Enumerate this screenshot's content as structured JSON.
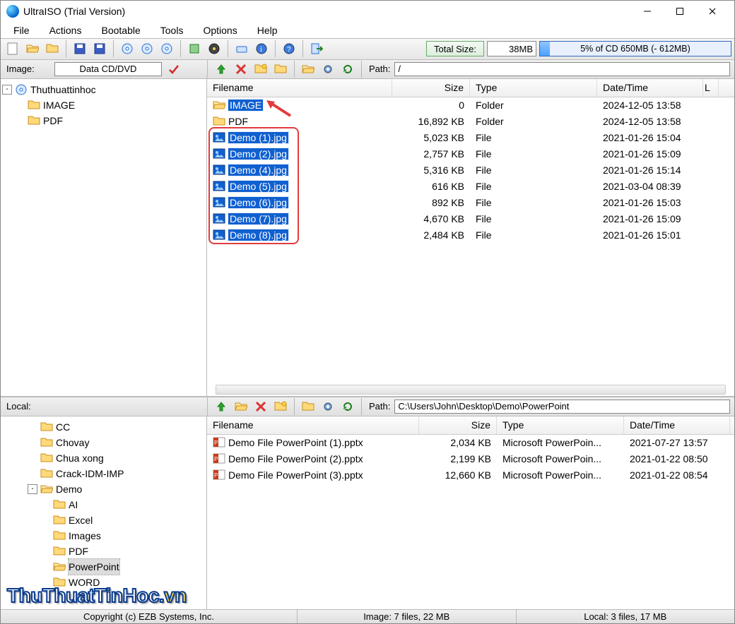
{
  "window": {
    "title": "UltraISO (Trial Version)"
  },
  "menu": [
    "File",
    "Actions",
    "Bootable",
    "Tools",
    "Options",
    "Help"
  ],
  "sizebar": {
    "label": "Total Size:",
    "value": "38MB",
    "progress_text": "5% of CD 650MB (- 612MB)",
    "progress_pct": 5
  },
  "image_toolbar": {
    "label": "Image:",
    "type_box": "Data CD/DVD",
    "path_label": "Path:",
    "path_value": "/"
  },
  "local_toolbar": {
    "label": "Local:",
    "path_label": "Path:",
    "path_value": "C:\\Users\\John\\Desktop\\Demo\\PowerPoint"
  },
  "image_tree": [
    {
      "depth": 0,
      "exp": "-",
      "icon": "disc",
      "label": "Thuthuattinhoc",
      "selected": false
    },
    {
      "depth": 1,
      "exp": "",
      "icon": "folder",
      "label": "IMAGE",
      "selected": false
    },
    {
      "depth": 1,
      "exp": "",
      "icon": "folder",
      "label": "PDF",
      "selected": false
    }
  ],
  "local_tree": [
    {
      "depth": 2,
      "exp": "",
      "icon": "folder",
      "label": "CC"
    },
    {
      "depth": 2,
      "exp": "",
      "icon": "folder",
      "label": "Chovay"
    },
    {
      "depth": 2,
      "exp": "",
      "icon": "folder",
      "label": "Chua xong"
    },
    {
      "depth": 2,
      "exp": "",
      "icon": "folder",
      "label": "Crack-IDM-IMP"
    },
    {
      "depth": 2,
      "exp": "-",
      "icon": "folder-open",
      "label": "Demo"
    },
    {
      "depth": 3,
      "exp": "",
      "icon": "folder",
      "label": "AI"
    },
    {
      "depth": 3,
      "exp": "",
      "icon": "folder",
      "label": "Excel"
    },
    {
      "depth": 3,
      "exp": "",
      "icon": "folder",
      "label": "Images"
    },
    {
      "depth": 3,
      "exp": "",
      "icon": "folder",
      "label": "PDF"
    },
    {
      "depth": 3,
      "exp": "",
      "icon": "folder-open",
      "label": "PowerPoint",
      "selected": true
    },
    {
      "depth": 3,
      "exp": "",
      "icon": "folder",
      "label": "WORD"
    }
  ],
  "list_columns": {
    "name": "Filename",
    "size": "Size",
    "type": "Type",
    "date": "Date/Time",
    "L": "L"
  },
  "image_files": [
    {
      "icon": "folder-open",
      "name": "IMAGE",
      "size": "0",
      "type": "Folder",
      "date": "2024-12-05 13:58",
      "selected": true,
      "folder_highlight": true
    },
    {
      "icon": "folder",
      "name": "PDF",
      "size": "16,892 KB",
      "type": "Folder",
      "date": "2024-12-05 13:58",
      "selected": false
    },
    {
      "icon": "img",
      "name": "Demo (1).jpg",
      "size": "5,023 KB",
      "type": "File",
      "date": "2021-01-26 15:04",
      "selected": true
    },
    {
      "icon": "img",
      "name": "Demo (2).jpg",
      "size": "2,757 KB",
      "type": "File",
      "date": "2021-01-26 15:09",
      "selected": true
    },
    {
      "icon": "img",
      "name": "Demo (4).jpg",
      "size": "5,316 KB",
      "type": "File",
      "date": "2021-01-26 15:14",
      "selected": true
    },
    {
      "icon": "img",
      "name": "Demo (5).jpg",
      "size": "616 KB",
      "type": "File",
      "date": "2021-03-04 08:39",
      "selected": true
    },
    {
      "icon": "img",
      "name": "Demo (6).jpg",
      "size": "892 KB",
      "type": "File",
      "date": "2021-01-26 15:03",
      "selected": true
    },
    {
      "icon": "img",
      "name": "Demo (7).jpg",
      "size": "4,670 KB",
      "type": "File",
      "date": "2021-01-26 15:09",
      "selected": true
    },
    {
      "icon": "img",
      "name": "Demo (8).jpg",
      "size": "2,484 KB",
      "type": "File",
      "date": "2021-01-26 15:01",
      "selected": true
    }
  ],
  "local_files": [
    {
      "icon": "pptx",
      "name": "Demo File PowerPoint (1).pptx",
      "size": "2,034 KB",
      "type": "Microsoft PowerPoin...",
      "date": "2021-07-27 13:57"
    },
    {
      "icon": "pptx",
      "name": "Demo File PowerPoint (2).pptx",
      "size": "2,199 KB",
      "type": "Microsoft PowerPoin...",
      "date": "2021-01-22 08:50"
    },
    {
      "icon": "pptx",
      "name": "Demo File PowerPoint (3).pptx",
      "size": "12,660 KB",
      "type": "Microsoft PowerPoin...",
      "date": "2021-01-22 08:54"
    }
  ],
  "status": {
    "copyright": "Copyright (c) EZB Systems, Inc.",
    "image_info": "Image: 7 files, 22 MB",
    "local_info": "Local: 3 files, 17 MB"
  },
  "watermark": {
    "main": "ThuThuatTinHoc",
    "suffix": ".vn"
  }
}
